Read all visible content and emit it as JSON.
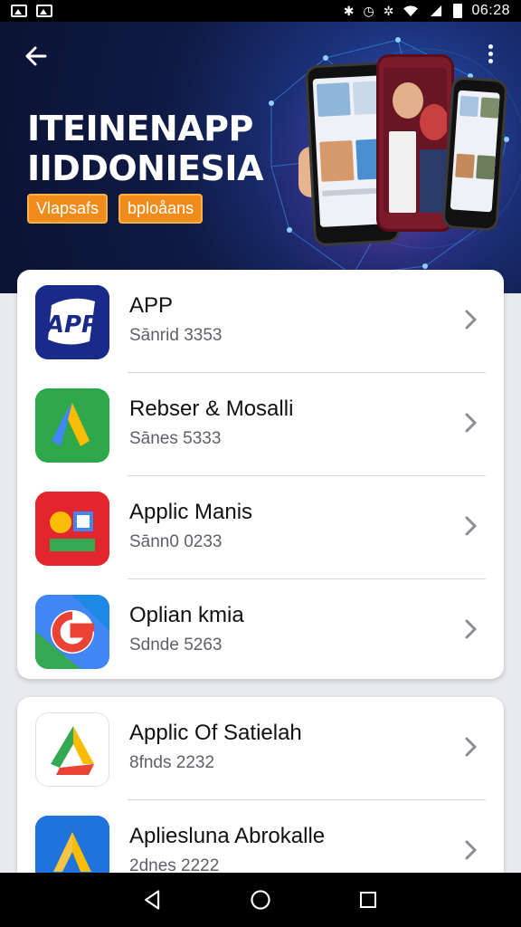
{
  "status_bar": {
    "time": "06:28",
    "left_icons": [
      "gallery-icon",
      "image-icon"
    ],
    "right_icons": [
      "bluetooth-icon",
      "alarm-icon",
      "vibrate-icon",
      "wifi-icon",
      "signal-icon",
      "battery-icon"
    ]
  },
  "header": {
    "title_line1": "ITEINENAPP",
    "title_line2": "IIDDONIESIA",
    "pills": [
      "Vlapsafs",
      "bploåans"
    ],
    "colors": {
      "pill": "#ef8c1c",
      "background": "#0f1a45"
    }
  },
  "list_main": [
    {
      "title": "APP",
      "subtitle": "Sānrid 3353",
      "icon": "app-logo-icon"
    },
    {
      "title": "Rebser & Mosalli",
      "subtitle": "Sānes 5333",
      "icon": "drive-triangle-icon"
    },
    {
      "title": "Applic Manis",
      "subtitle": "Sānn0 0233",
      "icon": "photos-icon"
    },
    {
      "title": "Oplian kmia",
      "subtitle": "Sdnde 5263",
      "icon": "google-g-icon"
    }
  ],
  "list_secondary": [
    {
      "title": "Applic Of Satielah",
      "subtitle": "8fnds 2232",
      "icon": "drive-icon"
    },
    {
      "title": "Apliesluna Abrokalle",
      "subtitle": "2dnes 2222",
      "icon": "drive-blue-icon"
    }
  ],
  "nav": {
    "back": "back-icon",
    "home": "home-icon",
    "recents": "recents-icon"
  }
}
